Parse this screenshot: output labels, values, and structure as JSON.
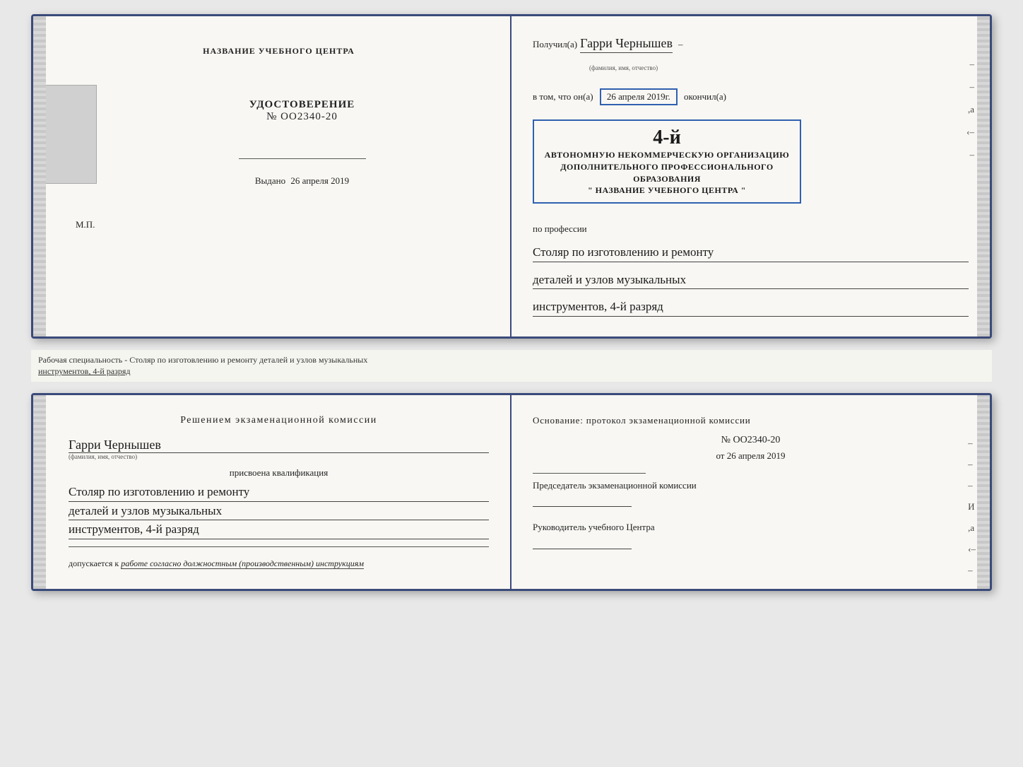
{
  "top_document": {
    "left_page": {
      "center_title": "НАЗВАНИЕ УЧЕБНОГО ЦЕНТРА",
      "udostoverenie_title": "УДОСТОВЕРЕНИЕ",
      "udostoverenie_number": "№ OO2340-20",
      "vydano_label": "Выдано",
      "vydano_date": "26 апреля 2019",
      "mp_label": "М.П."
    },
    "right_page": {
      "poluchil_label": "Получил(а)",
      "recipient_name": "Гарри Чернышев",
      "fio_label": "(фамилия, имя, отчество)",
      "vtom_label": "в том, что он(а)",
      "date_value": "26 апреля 2019г.",
      "okonchil_label": "окончил(а)",
      "stamp_number": "4-й",
      "stamp_line1": "АВТОНОМНУЮ НЕКОММЕРЧЕСКУЮ ОРГАНИЗАЦИЮ",
      "stamp_line2": "ДОПОЛНИТЕЛЬНОГО ПРОФЕССИОНАЛЬНОГО ОБРАЗОВАНИЯ",
      "stamp_line3": "\" НАЗВАНИЕ УЧЕБНОГО ЦЕНТРА \"",
      "po_professii_label": "по профессии",
      "qualification_line1": "Столяр по изготовлению и ремонту",
      "qualification_line2": "деталей и узлов музыкальных",
      "qualification_line3": "инструментов, 4-й разряд"
    }
  },
  "caption": {
    "text_part1": "Рабочая специальность - Столяр по изготовлению и ремонту деталей и узлов музыкальных",
    "text_part2": "инструментов, 4-й разряд"
  },
  "bottom_document": {
    "left_page": {
      "resheniyem_title": "Решением  экзаменационной  комиссии",
      "recipient_name": "Гарри Чернышев",
      "fio_label": "(фамилия, имя, отчество)",
      "prisvoena_label": "присвоена квалификация",
      "qualification_line1": "Столяр по изготовлению и ремонту",
      "qualification_line2": "деталей и узлов музыкальных",
      "qualification_line3": "инструментов, 4-й разряд",
      "dopuskaetsya_label": "допускается к",
      "dopuskaetsya_value": "работе согласно должностным (производственным) инструкциям"
    },
    "right_page": {
      "osnovanie_label": "Основание: протокол экзаменационной  комиссии",
      "number_label": "№  OO2340-20",
      "ot_label": "от",
      "ot_date": "26 апреля 2019",
      "predsedatel_label": "Председатель экзаменационной комиссии",
      "rukovoditel_label": "Руководитель учебного Центра"
    }
  }
}
